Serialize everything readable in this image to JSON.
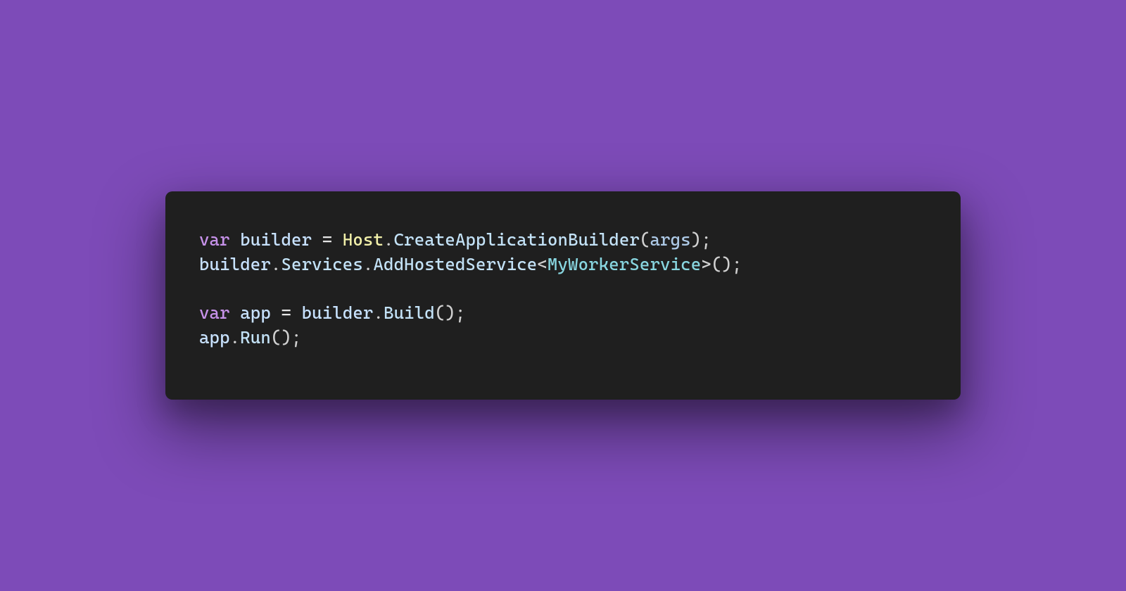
{
  "code": {
    "line1": {
      "kw_var": "var",
      "sp1": " ",
      "ident_builder": "builder",
      "sp2": " ",
      "eq": "=",
      "sp3": " ",
      "class_host": "Host",
      "dot1": ".",
      "method_cab": "CreateApplicationBuilder",
      "open1": "(",
      "param_args": "args",
      "close1": ")",
      "semi1": ";"
    },
    "line2": {
      "ident_builder": "builder",
      "dot1": ".",
      "prop_services": "Services",
      "dot2": ".",
      "method_ahs": "AddHostedService",
      "lt": "<",
      "type_mws": "MyWorkerService",
      "gt": ">",
      "open": "(",
      "close": ")",
      "semi": ";"
    },
    "line4": {
      "kw_var": "var",
      "sp1": " ",
      "ident_app": "app",
      "sp2": " ",
      "eq": "=",
      "sp3": " ",
      "ident_builder": "builder",
      "dot": ".",
      "method_build": "Build",
      "open": "(",
      "close": ")",
      "semi": ";"
    },
    "line5": {
      "ident_app": "app",
      "dot": ".",
      "method_run": "Run",
      "open": "(",
      "close": ")",
      "semi": ";"
    }
  }
}
